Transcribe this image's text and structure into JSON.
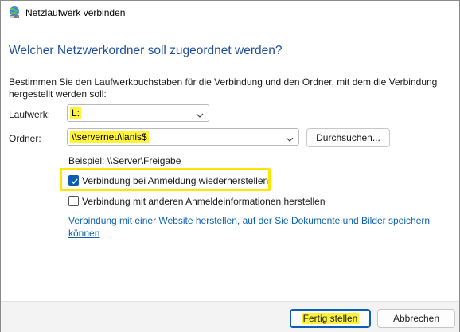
{
  "window": {
    "title": "Netzlaufwerk verbinden",
    "icon": "network-drive-icon"
  },
  "heading": "Welcher Netzwerkordner soll zugeordnet werden?",
  "description": "Bestimmen Sie den Laufwerkbuchstaben für die Verbindung und den Ordner, mit dem die Verbindung hergestellt werden soll:",
  "drive": {
    "label": "Laufwerk:",
    "value": "L:"
  },
  "folder": {
    "label": "Ordner:",
    "value": "\\\\serverneu\\lanis$",
    "browse_label": "Durchsuchen..."
  },
  "example": "Beispiel: \\\\Server\\Freigabe",
  "options": {
    "reconnect": {
      "label": "Verbindung bei Anmeldung wiederherstellen",
      "checked": true
    },
    "other_credentials": {
      "label": "Verbindung mit anderen Anmeldeinformationen herstellen",
      "checked": false
    }
  },
  "link": "Verbindung mit einer Website herstellen, auf der Sie Dokumente und Bilder speichern können",
  "buttons": {
    "finish": "Fertig stellen",
    "cancel": "Abbrechen"
  },
  "colors": {
    "accent": "#0a5fb4",
    "heading": "#1f4e9e",
    "highlight": "#fff33a",
    "link": "#0b61b5"
  }
}
